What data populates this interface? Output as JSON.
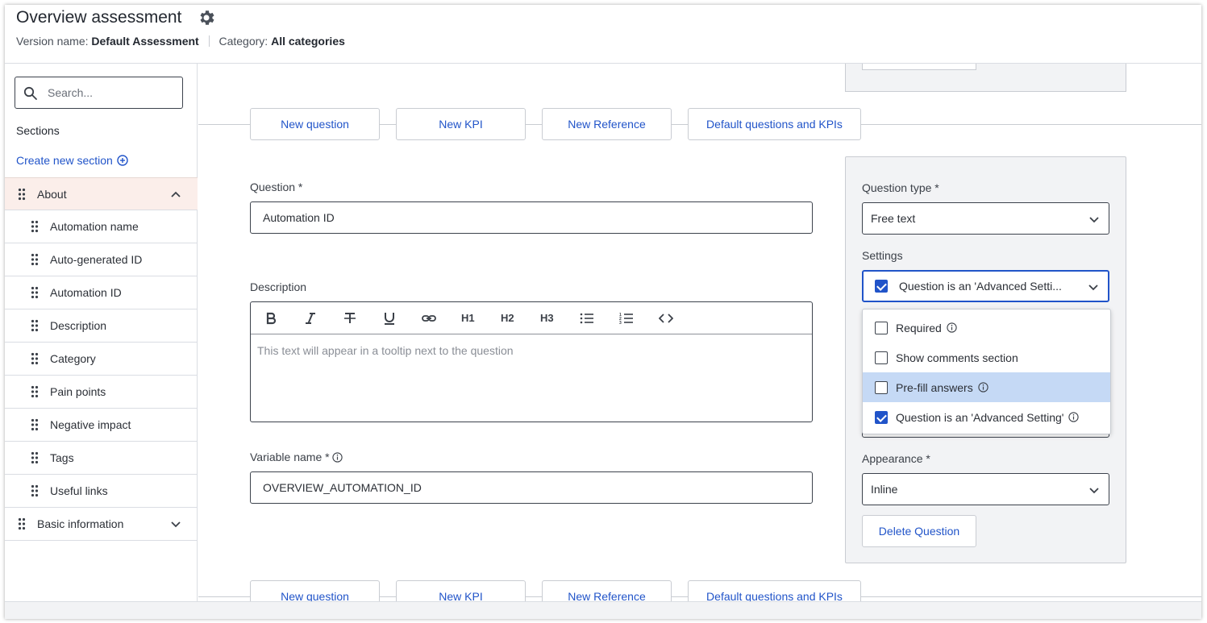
{
  "header": {
    "title": "Overview assessment",
    "version_label": "Version name:",
    "version_value": "Default Assessment",
    "category_label": "Category:",
    "category_value": "All categories"
  },
  "sidebar": {
    "search_placeholder": "Search...",
    "sections_label": "Sections",
    "create_section": "Create new section",
    "sections": [
      {
        "label": "About",
        "expanded": true,
        "items": [
          "Automation name",
          "Auto-generated ID",
          "Automation ID",
          "Description",
          "Category",
          "Pain points",
          "Negative impact",
          "Tags",
          "Useful links"
        ]
      },
      {
        "label": "Basic information",
        "expanded": false
      }
    ]
  },
  "add_bar": {
    "new_question": "New question",
    "new_kpi": "New KPI",
    "new_reference": "New Reference",
    "default_questions": "Default questions and KPIs"
  },
  "form": {
    "question_label": "Question *",
    "question_value": "Automation ID",
    "description_label": "Description",
    "description_placeholder": "This text will appear in a tooltip next to the question",
    "toolbar": [
      "bold",
      "italic",
      "strikethrough",
      "underline",
      "link",
      "H1",
      "H2",
      "H3",
      "bullet-list",
      "numbered-list",
      "code"
    ],
    "variable_label": "Variable name *",
    "variable_value": "OVERVIEW_AUTOMATION_ID"
  },
  "panel": {
    "question_type_label": "Question type *",
    "question_type_value": "Free text",
    "settings_label": "Settings",
    "settings_value": "Question is an 'Advanced Setti...",
    "settings_options": [
      {
        "label": "Required",
        "checked": false,
        "info": true,
        "highlighted": false
      },
      {
        "label": "Show comments section",
        "checked": false,
        "info": false,
        "highlighted": false
      },
      {
        "label": "Pre-fill answers",
        "checked": false,
        "info": true,
        "highlighted": true
      },
      {
        "label": "Question is an 'Advanced Setting'",
        "checked": true,
        "info": true,
        "highlighted": false
      }
    ],
    "appearance_label": "Appearance *",
    "appearance_value": "Inline",
    "delete_button": "Delete Question"
  },
  "colors": {
    "accent": "#2154c9",
    "active_row_bg": "#fbeeea",
    "panel_bg": "#f2f3f5",
    "highlight_option": "#c5d9f5"
  }
}
